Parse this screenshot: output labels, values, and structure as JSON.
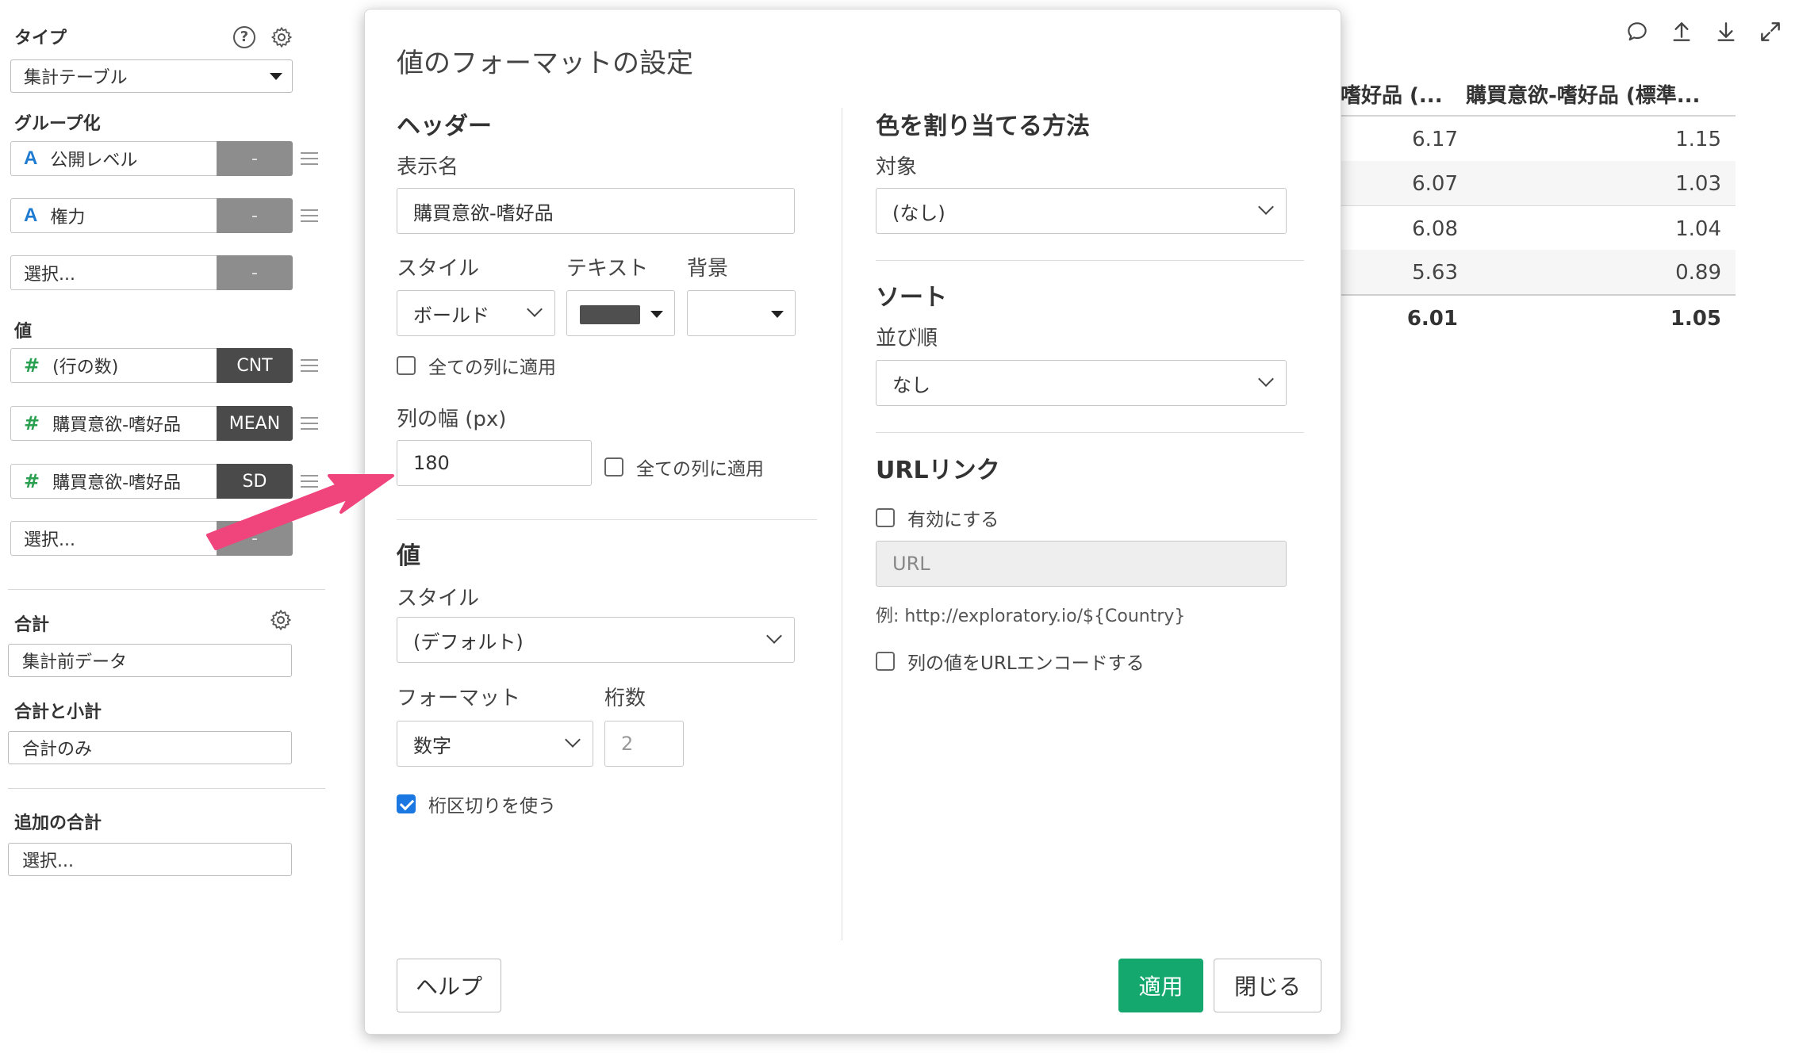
{
  "sidebar": {
    "type_label": "タイプ",
    "type_value": "集計テーブル",
    "group_label": "グループ化",
    "group_items": [
      {
        "type": "A",
        "name": "公開レベル",
        "agg": "-"
      },
      {
        "type": "A",
        "name": "権力",
        "agg": "-"
      }
    ],
    "group_select": "選択...",
    "group_select_agg": "-",
    "value_label": "値",
    "value_items": [
      {
        "type": "#",
        "name": "(行の数)",
        "agg": "CNT"
      },
      {
        "type": "#",
        "name": "購買意欲-嗜好品",
        "agg": "MEAN"
      },
      {
        "type": "#",
        "name": "購買意欲-嗜好品",
        "agg": "SD"
      }
    ],
    "value_select": "選択...",
    "value_select_agg": "-",
    "total_label": "合計",
    "total_value": "集計前データ",
    "subtotal_label": "合計と小計",
    "subtotal_value": "合計のみ",
    "extra_total_label": "追加の合計",
    "extra_total_value": "選択...",
    "help_glyph": "?"
  },
  "table": {
    "col1_header": "嗜好品 (...",
    "col2_header": "購買意欲-嗜好品 (標準...",
    "rows": [
      {
        "c1": "6.17",
        "c2": "1.15"
      },
      {
        "c1": "6.07",
        "c2": "1.03"
      },
      {
        "c1": "6.08",
        "c2": "1.04"
      },
      {
        "c1": "5.63",
        "c2": "0.89"
      }
    ],
    "total_row": {
      "c1": "6.01",
      "c2": "1.05"
    }
  },
  "modal": {
    "title": "値のフォーマットの設定",
    "header_section": "ヘッダー",
    "display_name_label": "表示名",
    "display_name_value": "購買意欲-嗜好品",
    "style_label": "スタイル",
    "text_label": "テキスト",
    "bg_label": "背景",
    "style_value": "ボールド",
    "text_color": "#4f4f4f",
    "apply_all_cols_1": "全ての列に適用",
    "col_width_label": "列の幅 (px)",
    "col_width_value": "180",
    "apply_all_cols_2": "全ての列に適用",
    "value_section": "値",
    "value_style_label": "スタイル",
    "value_style_value": "(デフォルト)",
    "format_label": "フォーマット",
    "digits_label": "桁数",
    "format_value": "数字",
    "digits_value": "2",
    "thousands_sep": "桁区切りを使う",
    "color_section": "色を割り当てる方法",
    "target_label": "対象",
    "target_value": "(なし)",
    "sort_section": "ソート",
    "order_label": "並び順",
    "order_value": "なし",
    "url_section": "URLリンク",
    "enable_label": "有効にする",
    "url_placeholder": "URL",
    "url_example": "例: http://exploratory.io/${Country}",
    "url_encode": "列の値をURLエンコードする",
    "help_button": "ヘルプ",
    "apply_button": "適用",
    "close_button": "閉じる"
  },
  "colors": {
    "primary": "#14a86e",
    "checkbox": "#1b78e2",
    "annotation_arrow": "#f0447c"
  }
}
